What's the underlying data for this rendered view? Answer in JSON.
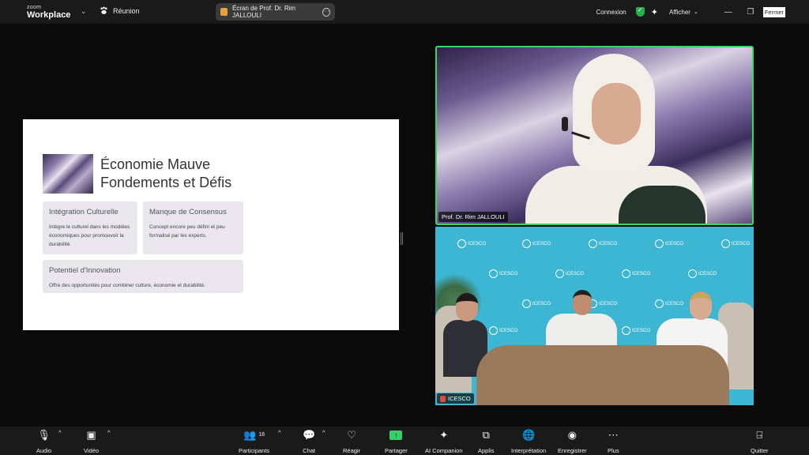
{
  "titlebar": {
    "logo_top": "zoom",
    "logo_bottom": "Workplace",
    "meeting_label": "Réunion",
    "share_label": "Écran de Prof. Dr. Rim JALLOULI",
    "connexion": "Connexion",
    "afficher": "Afficher",
    "fermer": "Fermer"
  },
  "slide": {
    "title_line1": "Économie Mauve",
    "title_line2": "Fondements et Défis",
    "cards": [
      {
        "title": "Intégration Culturelle",
        "text": "Intègre le culturel dans les modèles économiques pour promouvoir la durabilité."
      },
      {
        "title": "Manque de Consensus",
        "text": "Concept encore peu défini et peu formalisé par les experts."
      },
      {
        "title": "Potentiel d'Innovation",
        "text": "Offre des opportunités pour combiner culture, économie et durabilité."
      }
    ]
  },
  "videos": [
    {
      "name": "Prof. Dr. Rim JALLOULI"
    },
    {
      "name": "ICESCO"
    }
  ],
  "backdrop_logo_text": "ICESCO",
  "toolbar": {
    "audio": "Audio",
    "video": "Vidéo",
    "participants": "Participants",
    "participants_count": "18",
    "chat": "Chat",
    "react": "Réagir",
    "share": "Partager",
    "ai": "AI Companion",
    "apps": "Applis",
    "interpretation": "Interprétation",
    "record": "Enregistrer",
    "more": "Plus",
    "quit": "Quitter"
  },
  "colors": {
    "active_speaker": "#3bd36c",
    "share_green": "#36d06a",
    "mute_red": "#e5483e"
  }
}
